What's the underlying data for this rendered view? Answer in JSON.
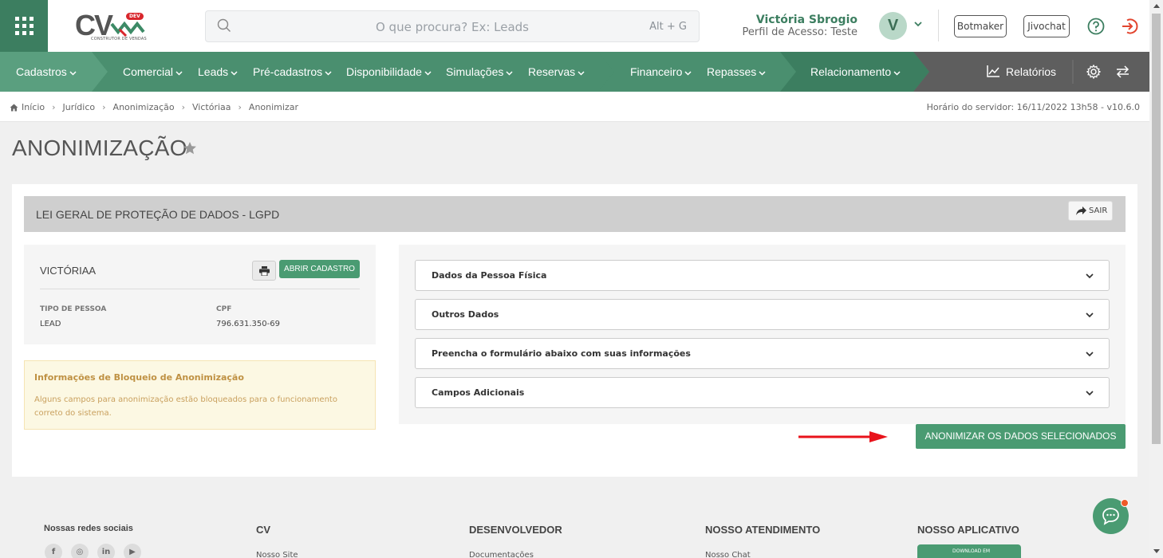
{
  "colors": {
    "brand_green": "#4a8f6f",
    "dark_green": "#3c7e60",
    "button_green": "#4a9b72",
    "exit_red": "#e2452f",
    "arrow_red": "#e8131b"
  },
  "header": {
    "logo_text": "CV",
    "logo_badge": "DEV",
    "logo_subtitle": "CONSTRUTOR DE VENDAS",
    "search_placeholder": "O que procura? Ex: Leads",
    "search_shortcut": "Alt + G",
    "user_name": "Victória Sbrogio",
    "user_profile": "Perfil de Acesso: Teste",
    "avatar_letter": "V",
    "botmaker_label": "Botmaker",
    "jivochat_label": "Jivochat"
  },
  "nav": {
    "items": [
      {
        "label": "Cadastros"
      },
      {
        "label": "Comercial"
      },
      {
        "label": "Leads"
      },
      {
        "label": "Pré-cadastros"
      },
      {
        "label": "Disponibilidade"
      },
      {
        "label": "Simulações"
      },
      {
        "label": "Reservas"
      },
      {
        "label": "Financeiro"
      },
      {
        "label": "Repasses"
      },
      {
        "label": "Relacionamento"
      }
    ],
    "reports_label": "Relatórios"
  },
  "breadcrumb": {
    "items": [
      "Início",
      "Jurídico",
      "Anonimização",
      "Victóriaa",
      "Anonimizar"
    ],
    "server_time": "Horário do servidor: 16/11/2022 13h58 - v10.6.0"
  },
  "page": {
    "title": "ANONIMIZAÇÃO",
    "section_title": "LEI GERAL DE PROTEÇÃO DE DADOS - LGPD",
    "exit_label": "SAIR"
  },
  "person": {
    "name": "VICTÓRIAA",
    "open_record_label": "ABRIR CADASTRO",
    "person_type_label": "TIPO DE PESSOA",
    "person_type_value": "LEAD",
    "cpf_label": "CPF",
    "cpf_value": "796.631.350-69"
  },
  "warning": {
    "title": "Informações de Bloqueio de Anonimização",
    "text": "Alguns campos para anonimização estão bloqueados para o funcionamento correto do sistema."
  },
  "accordion": {
    "items": [
      {
        "label": "Dados da Pessoa Física"
      },
      {
        "label": "Outros Dados"
      },
      {
        "label": "Preencha o formulário abaixo com suas informações"
      },
      {
        "label": "Campos Adicionais"
      }
    ]
  },
  "anonymize_button_label": "ANONIMIZAR OS DADOS SELECIONADOS",
  "footer": {
    "social_heading": "Nossas redes sociais",
    "social": {
      "facebook": "f",
      "instagram": "◎",
      "linkedin": "in",
      "youtube": "▶"
    },
    "cv_heading": "CV",
    "cv_link": "Nosso Site",
    "dev_heading": "DESENVOLVEDOR",
    "dev_link": "Documentações",
    "support_heading": "NOSSO ATENDIMENTO",
    "support_link": "Nosso Chat",
    "app_heading": "NOSSO APLICATIVO",
    "app_badge_text": "DOWNLOAD EM"
  }
}
